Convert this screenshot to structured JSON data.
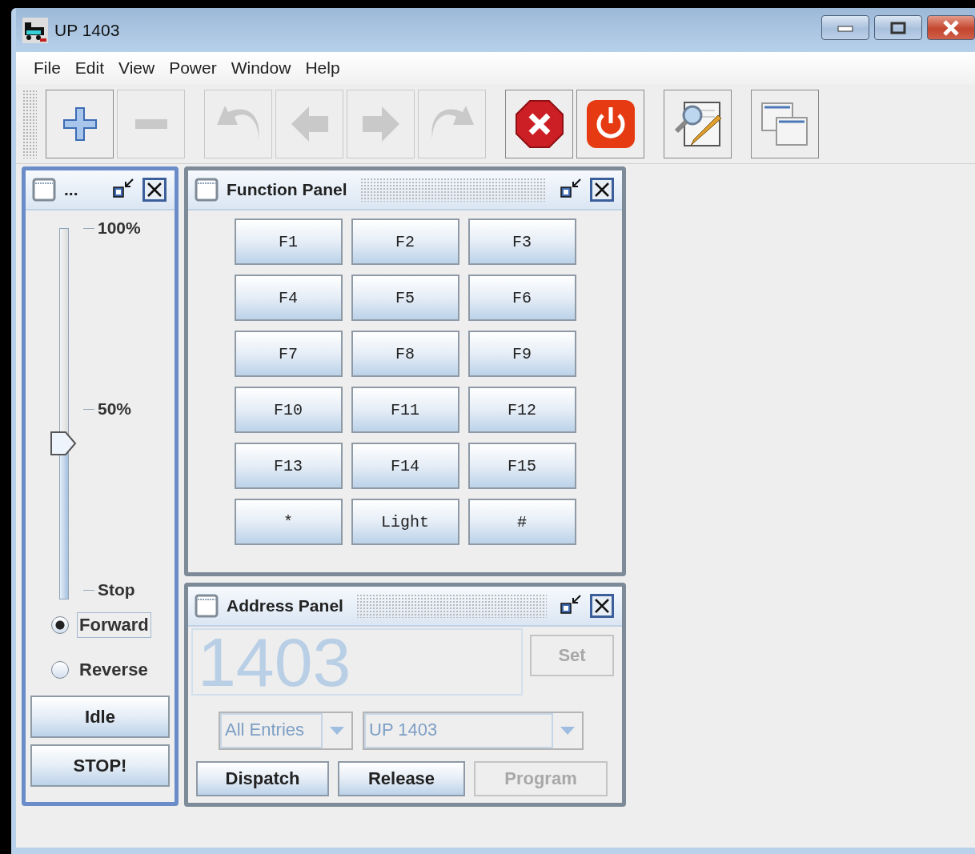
{
  "window": {
    "title": "UP 1403"
  },
  "menu": [
    "File",
    "Edit",
    "View",
    "Power",
    "Window",
    "Help"
  ],
  "toolbar": {
    "groups": [
      {
        "buttons": [
          {
            "kind": "add",
            "disabled": false
          },
          {
            "kind": "remove",
            "disabled": true
          }
        ]
      },
      {
        "buttons": [
          {
            "kind": "undo",
            "disabled": true
          },
          {
            "kind": "back",
            "disabled": true
          },
          {
            "kind": "forward",
            "disabled": true
          },
          {
            "kind": "redo",
            "disabled": true
          }
        ]
      },
      {
        "buttons": [
          {
            "kind": "stop",
            "disabled": false
          },
          {
            "kind": "power",
            "disabled": false
          }
        ]
      },
      {
        "buttons": [
          {
            "kind": "edit",
            "disabled": false
          }
        ]
      },
      {
        "buttons": [
          {
            "kind": "windows",
            "disabled": false
          }
        ]
      }
    ]
  },
  "throttle_frame": {
    "title": "...",
    "active": true,
    "speed": {
      "level": 0.42,
      "ticks": [
        "100%",
        "50%",
        "Stop"
      ]
    },
    "directions": [
      {
        "label": "Forward",
        "selected": true
      },
      {
        "label": "Reverse",
        "selected": false
      }
    ],
    "buttons": [
      "Idle",
      "STOP!"
    ]
  },
  "function_panel": {
    "title": "Function Panel",
    "active": false,
    "buttons": [
      "F1",
      "F2",
      "F3",
      "F4",
      "F5",
      "F6",
      "F7",
      "F8",
      "F9",
      "F10",
      "F11",
      "F12",
      "F13",
      "F14",
      "F15",
      "*",
      "Light",
      "#"
    ]
  },
  "address_panel": {
    "title": "Address Panel",
    "active": false,
    "address": "1403",
    "set_button": {
      "label": "Set",
      "disabled": true
    },
    "selectors": [
      {
        "value": "All Entries",
        "disabled": true
      },
      {
        "value": "UP 1403",
        "disabled": true
      }
    ],
    "buttons": [
      {
        "label": "Dispatch",
        "disabled": false
      },
      {
        "label": "Release",
        "disabled": false
      },
      {
        "label": "Program",
        "disabled": true
      }
    ]
  }
}
